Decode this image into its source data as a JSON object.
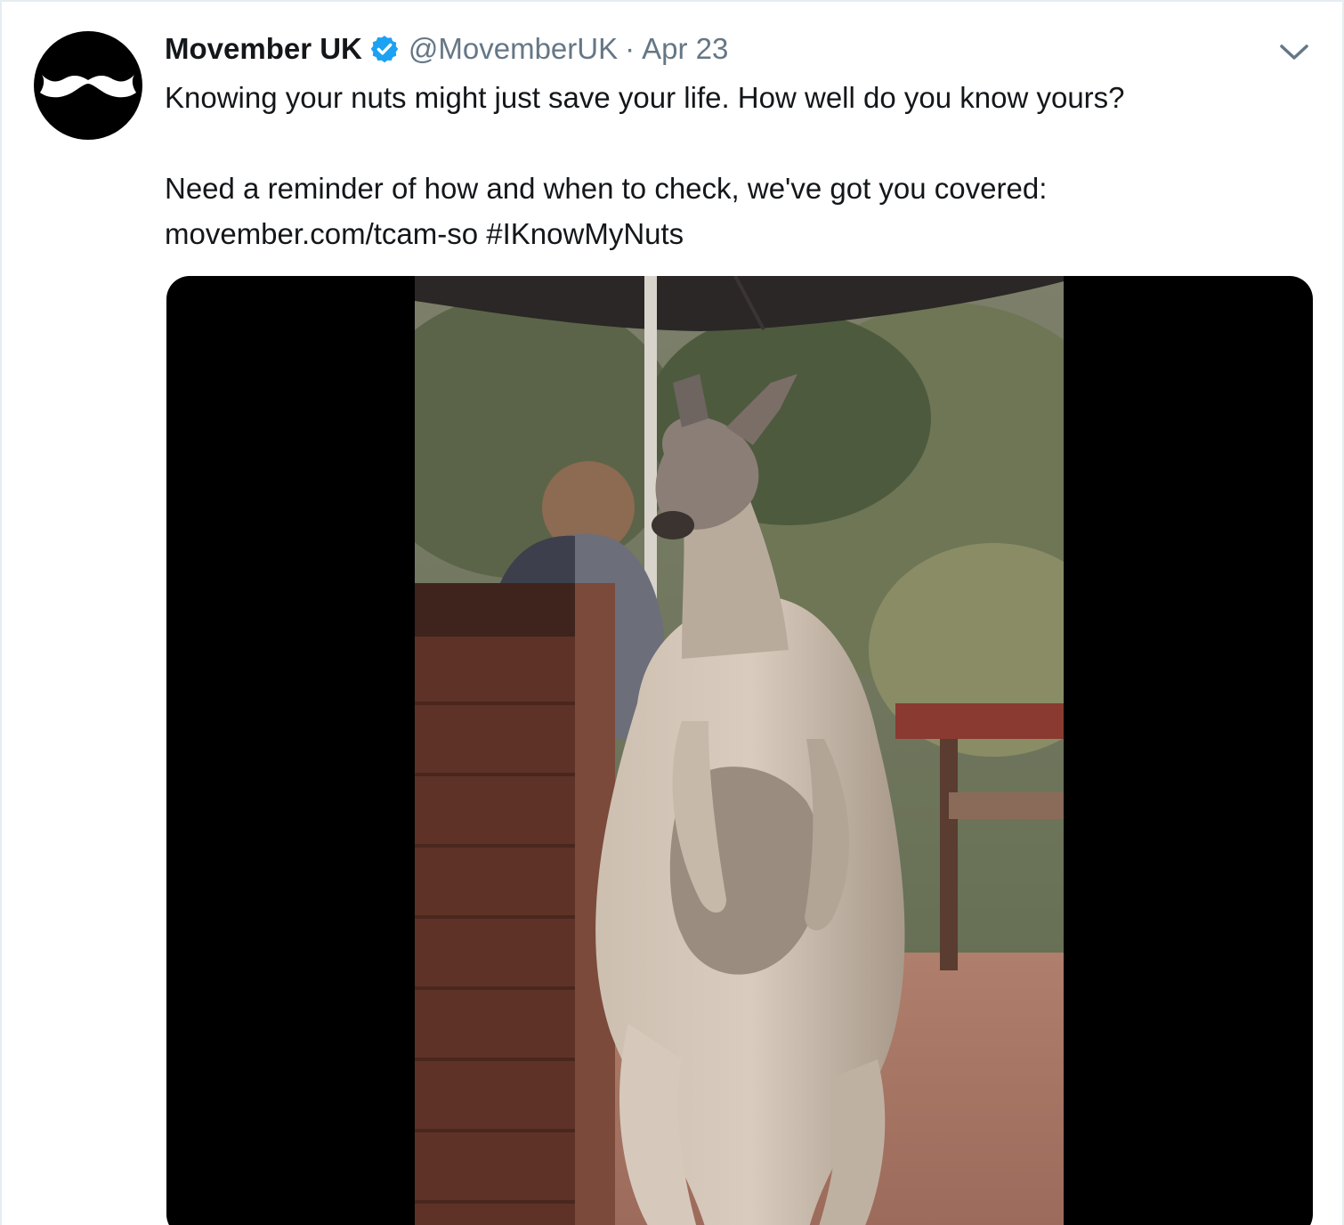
{
  "tweet": {
    "display_name": "Movember UK",
    "verified": true,
    "handle": "@MovemberUK",
    "separator": "·",
    "date": "Apr 23",
    "line1": "Knowing your nuts might just save your life. How well do you know yours?",
    "line2": "Need a reminder of how and when to check, we've got you covered:",
    "link": "movember.com/tcam-so",
    "hashtag": "#IKnowMyNuts"
  },
  "icons": {
    "avatar": "moustache-logo",
    "verified": "verified-badge-icon",
    "menu": "chevron-down-icon"
  },
  "colors": {
    "verified_blue": "#1da1f2",
    "text": "#14171a",
    "muted": "#657786"
  },
  "media": {
    "type": "video",
    "subject": "kangaroo"
  }
}
